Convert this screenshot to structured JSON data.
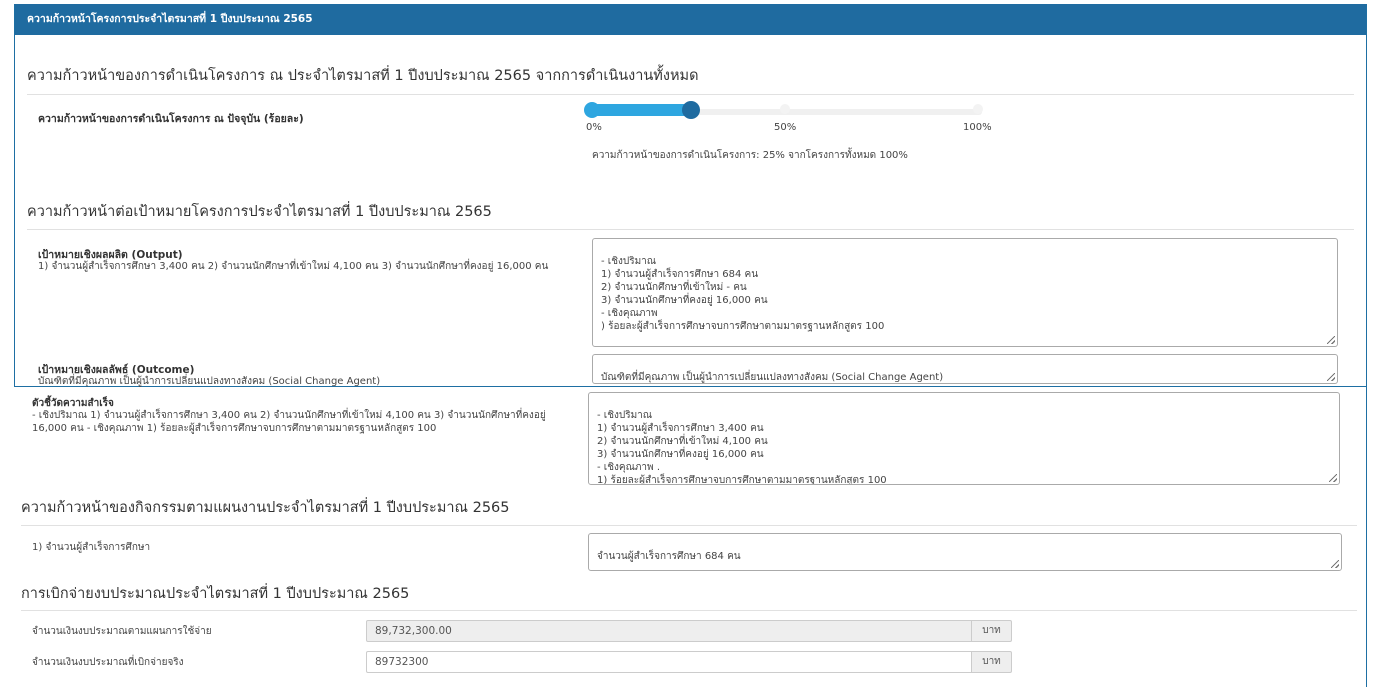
{
  "header": {
    "title": "ความก้าวหน้าโครงการประจำไตรมาสที่ 1 ปีงบประมาณ 2565"
  },
  "section1": {
    "title": "ความก้าวหน้าของการดำเนินโครงการ ณ ประจำไตรมาสที่ 1 ปีงบประมาณ 2565 จากการดำเนินงานทั้งหมด",
    "progress_label": "ความก้าวหน้าของการดำเนินโครงการ ณ ปัจจุบัน (ร้อยละ)",
    "progress_value": 25,
    "ticks": [
      "0%",
      "50%",
      "100%"
    ],
    "progress_text": "ความก้าวหน้าของการดำเนินโครงการ: 25% จากโครงการทั้งหมด 100%",
    "colors": {
      "fill": "#2ea6e0",
      "knob": "#1f6ba0"
    }
  },
  "section2": {
    "title": "ความก้าวหน้าต่อเป้าหมายโครงการประจำไตรมาสที่ 1 ปีงบประมาณ 2565",
    "output": {
      "label": "เป้าหมายเชิงผลผลิต (Output)",
      "desc": "1) จำนวนผู้สำเร็จการศึกษา 3,400 คน 2) จำนวนนักศึกษาที่เข้าใหม่ 4,100 คน 3) จำนวนนักศึกษาที่คงอยู่ 16,000 คน",
      "value": "- เชิงปริมาณ\n1) จำนวนผู้สำเร็จการศึกษา 684 คน\n2) จำนวนนักศึกษาที่เข้าใหม่ -  คน\n3) จำนวนนักศึกษาที่คงอยู่ 16,000 คน\n- เชิงคุณภาพ\n) ร้อยละผู้สำเร็จการศึกษาจบการศึกษาตามมาตรฐานหลักสูตร 100"
    },
    "outcome": {
      "label": "เป้าหมายเชิงผลลัพธ์ (Outcome)",
      "desc": "บัณฑิตที่มีคุณภาพ เป็นผู้นำการเปลี่ยนแปลงทางสังคม (Social Change Agent)",
      "value": "บัณฑิตที่มีคุณภาพ เป็นผู้นำการเปลี่ยนแปลงทางสังคม (Social Change Agent)"
    },
    "kpi": {
      "label": "ตัวชี้วัดความสำเร็จ",
      "desc": "- เชิงปริมาณ 1) จำนวนผู้สำเร็จการศึกษา 3,400 คน 2) จำนวนนักศึกษาที่เข้าใหม่ 4,100 คน 3) จำนวนนักศึกษาที่คงอยู่ 16,000 คน - เชิงคุณภาพ 1) ร้อยละผู้สำเร็จการศึกษาจบการศึกษาตามมาตรฐานหลักสูตร 100",
      "value": "- เชิงปริมาณ\n1) จำนวนผู้สำเร็จการศึกษา 3,400 คน\n2) จำนวนนักศึกษาที่เข้าใหม่ 4,100 คน\n3) จำนวนนักศึกษาที่คงอยู่ 16,000 คน\n- เชิงคุณภาพ .\n1) ร้อยละผู้สำเร็จการศึกษาจบการศึกษาตามมาตรฐานหลักสูตร 100"
    }
  },
  "section3": {
    "title": "ความก้าวหน้าของกิจกรรมตามแผนงานประจำไตรมาสที่ 1 ปีงบประมาณ 2565",
    "activity_label": "1) จำนวนผู้สำเร็จการศึกษา",
    "activity_value": "จำนวนผู้สำเร็จการศึกษา 684 คน"
  },
  "section4": {
    "title": "การเบิกจ่ายงบประมาณประจำไตรมาสที่ 1 ปีงบประมาณ 2565",
    "plan_label": "จำนวนเงินงบประมาณตามแผนการใช้จ่าย",
    "plan_value": "89,732,300.00",
    "actual_label": "จำนวนเงินงบประมาณที่เบิกจ่ายจริง",
    "actual_value": "89732300",
    "unit": "บาท"
  }
}
